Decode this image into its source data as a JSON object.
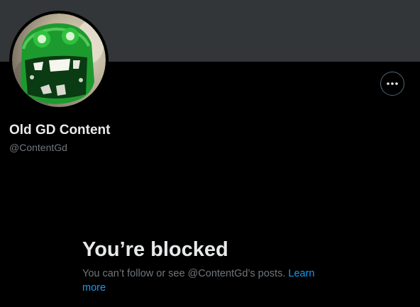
{
  "profile": {
    "display_name": "Old GD Content",
    "handle": "@ContentGd",
    "avatar_icon": "profile-avatar-image",
    "more_icon": "more-horizontal-icon"
  },
  "blocked": {
    "title": "You’re blocked",
    "description": "You can’t follow or see @ContentGd’s posts. ",
    "learn_more": "Learn more"
  },
  "colors": {
    "background": "#000000",
    "banner": "#333639",
    "primary_text": "#e7e9ea",
    "secondary_text": "#71767b",
    "link": "#1d9bf0"
  }
}
